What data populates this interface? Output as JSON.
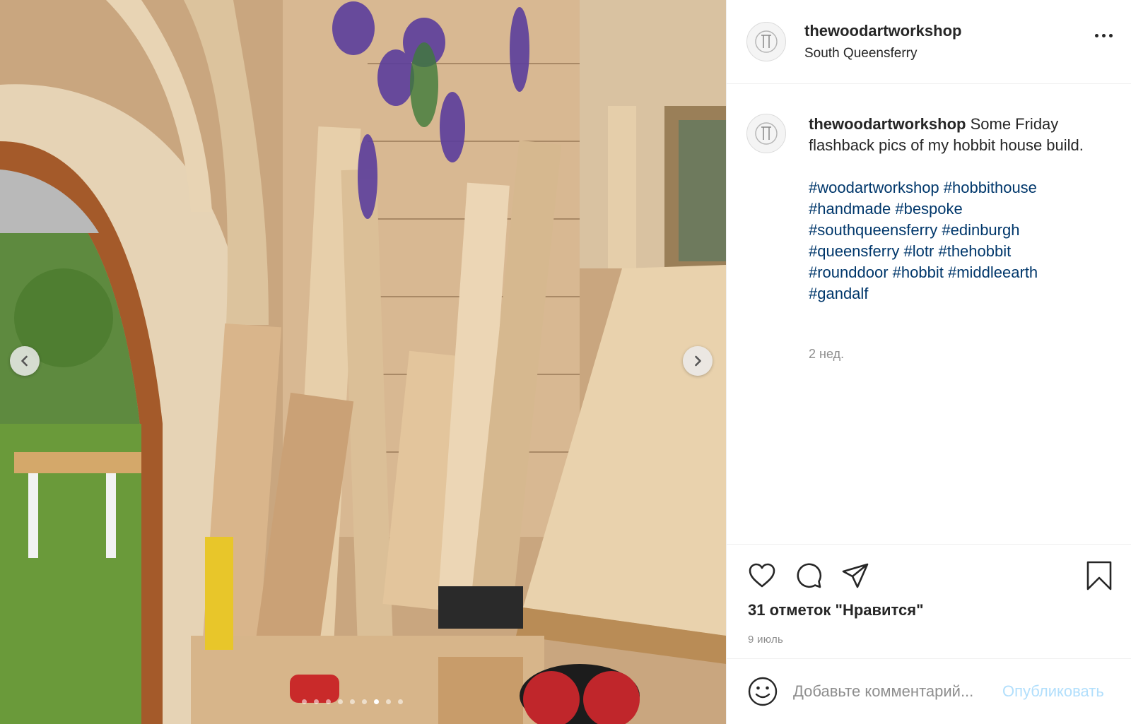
{
  "post": {
    "username": "thewoodartworkshop",
    "location": "South Queensferry",
    "caption": "Some Friday flashback pics of my hobbit house build.",
    "hashtag_lines": [
      [
        "#woodartworkshop",
        "#hobbithouse"
      ],
      [
        "#handmade",
        "#bespoke"
      ],
      [
        "#southqueensferry",
        "#edinburgh"
      ],
      [
        "#queensferry",
        "#lotr",
        "#thehobbit"
      ],
      [
        "#rounddoor",
        "#hobbit",
        "#middleearth"
      ],
      [
        "#gandalf"
      ]
    ],
    "time_ago": "2 нед.",
    "likes": "31 отметок \"Нравится\"",
    "date": "9 июль"
  },
  "comment": {
    "placeholder": "Добавьте комментарий...",
    "publish_label": "Опубликовать"
  },
  "carousel": {
    "total": 9,
    "active_index": 6
  },
  "icons": {
    "more": "more-options-icon",
    "like": "heart-icon",
    "comment": "comment-bubble-icon",
    "share": "paper-plane-icon",
    "save": "bookmark-icon",
    "emoji": "smiley-icon",
    "prev": "chevron-left-icon",
    "next": "chevron-right-icon"
  },
  "colors": {
    "hashtag": "#00376b",
    "publish_disabled": "#b2dffc",
    "muted_text": "#8e8e8e"
  }
}
